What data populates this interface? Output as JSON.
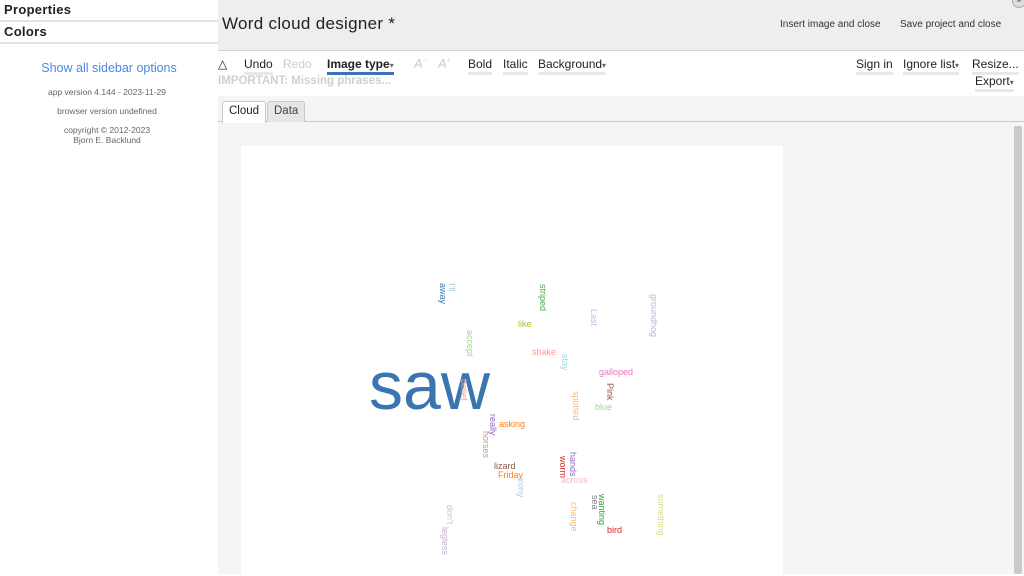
{
  "sidebar": {
    "sections": [
      "Properties",
      "Colors"
    ],
    "show_all_link": "Show all sidebar options",
    "app_version": "app version 4.144 - 2023-11-29",
    "browser_version": "browser version undefined",
    "copyright_line1": "copyright © 2012-2023",
    "copyright_line2": "Bjorn E. Backlund"
  },
  "header": {
    "title": "Word cloud designer *",
    "insert_button": "Insert image and close",
    "save_button": "Save project and close",
    "menu_icon": "menu-icon"
  },
  "toolbar": {
    "warning_icon": "△",
    "undo": "Undo",
    "redo": "Redo",
    "image_type": "Image type",
    "decrease_font_icon": "A",
    "increase_font_icon": "A",
    "bold": "Bold",
    "italic": "Italic",
    "background": "Background",
    "sign_in": "Sign in",
    "ignore_list": "Ignore list",
    "resize": "Resize...",
    "export": "Export",
    "caret": "▾",
    "important": "IMPORTANT: Missing phrases..."
  },
  "tabs": [
    {
      "label": "Cloud",
      "active": true
    },
    {
      "label": "Data",
      "active": false
    }
  ],
  "cloud": {
    "words": [
      {
        "text": "saw",
        "color": "#3a75b0",
        "size": 68,
        "vertical": false
      },
      {
        "text": "I'll",
        "color": "#9ec9e2",
        "size": 9,
        "vertical": true
      },
      {
        "text": "away",
        "color": "#3a75b0",
        "size": 9,
        "vertical": true
      },
      {
        "text": "striped",
        "color": "#4caa4c",
        "size": 9,
        "vertical": true
      },
      {
        "text": "like",
        "color": "#bcbd22",
        "size": 9,
        "vertical": false
      },
      {
        "text": "Last",
        "color": "#aec7e8",
        "size": 9,
        "vertical": true
      },
      {
        "text": "groundhog",
        "color": "#c5b0d5",
        "size": 9,
        "vertical": true
      },
      {
        "text": "accept",
        "color": "#98df8a",
        "size": 9,
        "vertical": true
      },
      {
        "text": "shake",
        "color": "#ff9896",
        "size": 9,
        "vertical": false
      },
      {
        "text": "stay",
        "color": "#9edae5",
        "size": 9,
        "vertical": true
      },
      {
        "text": "galloped",
        "color": "#e377c2",
        "size": 9,
        "vertical": false
      },
      {
        "text": "belief",
        "color": "#ff9896",
        "size": 9,
        "vertical": true
      },
      {
        "text": "Pink",
        "color": "#8c564b",
        "size": 9,
        "vertical": true
      },
      {
        "text": "spotted",
        "color": "#ffbb78",
        "size": 9,
        "vertical": true
      },
      {
        "text": "blue",
        "color": "#98df8a",
        "size": 9,
        "vertical": false
      },
      {
        "text": "really",
        "color": "#9467bd",
        "size": 9,
        "vertical": true
      },
      {
        "text": "asking",
        "color": "#ff7f0e",
        "size": 9,
        "vertical": false
      },
      {
        "text": "horses",
        "color": "#c49c94",
        "size": 9,
        "vertical": true
      },
      {
        "text": "hands",
        "color": "#9467bd",
        "size": 9,
        "vertical": true
      },
      {
        "text": "worm",
        "color": "#d62728",
        "size": 9,
        "vertical": true
      },
      {
        "text": "lizard",
        "color": "#8c564b",
        "size": 9,
        "vertical": false
      },
      {
        "text": "Friday",
        "color": "#ff7f0e",
        "size": 9,
        "vertical": false
      },
      {
        "text": "across",
        "color": "#f7b6d2",
        "size": 9,
        "vertical": false
      },
      {
        "text": "irony",
        "color": "#aec7e8",
        "size": 9,
        "vertical": true
      },
      {
        "text": "wanting",
        "color": "#2ca02c",
        "size": 9,
        "vertical": true
      },
      {
        "text": "sea",
        "color": "#7f7f7f",
        "size": 9,
        "vertical": true
      },
      {
        "text": "something",
        "color": "#dbdb8d",
        "size": 9,
        "vertical": true
      },
      {
        "text": "don't",
        "color": "#c7c7c7",
        "size": 9,
        "vertical": true
      },
      {
        "text": "change",
        "color": "#ffbb78",
        "size": 9,
        "vertical": true
      },
      {
        "text": "legless",
        "color": "#c5b0d5",
        "size": 9,
        "vertical": true
      },
      {
        "text": "bird",
        "color": "#d62728",
        "size": 9,
        "vertical": false
      }
    ]
  }
}
